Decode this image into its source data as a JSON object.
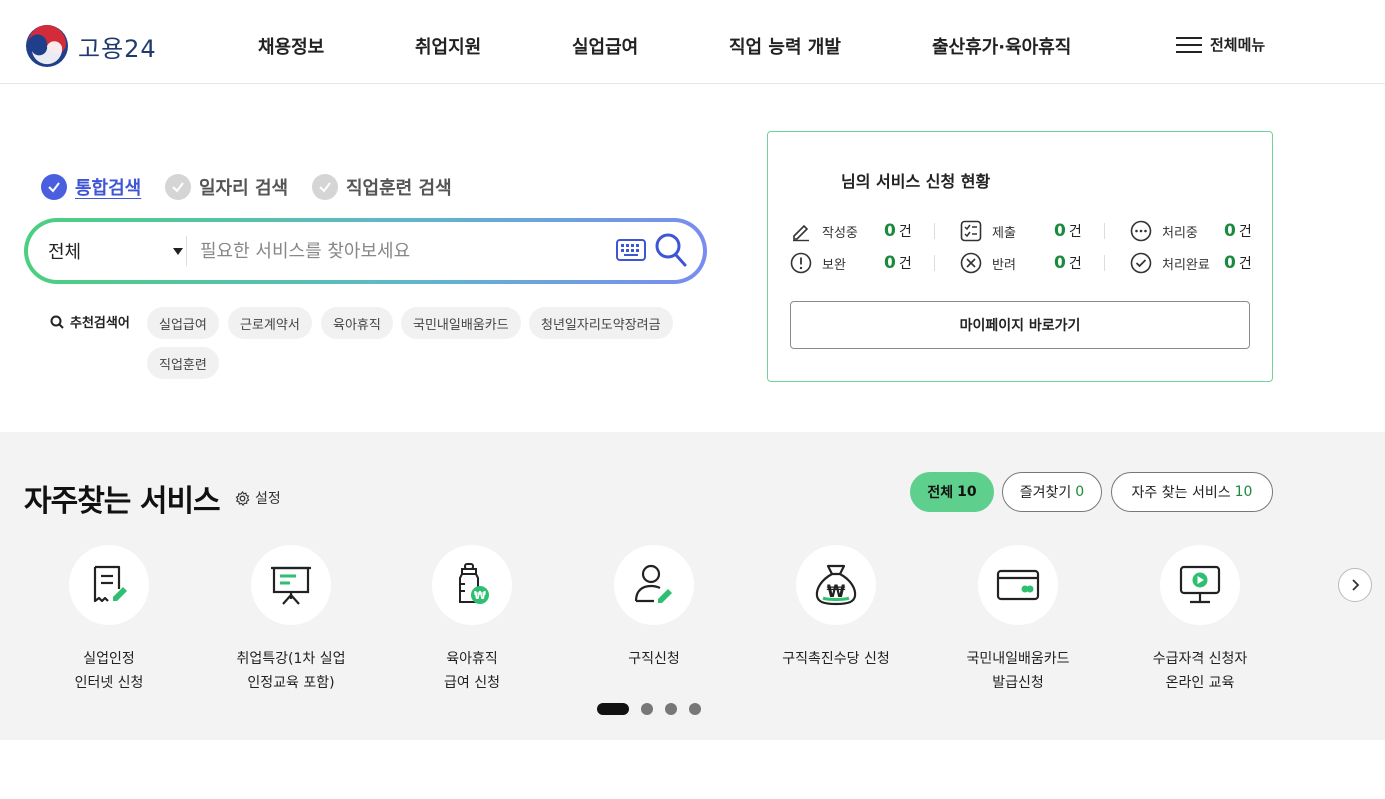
{
  "header": {
    "logo_text": "고용24",
    "nav": [
      "채용정보",
      "취업지원",
      "실업급여",
      "직업 능력 개발",
      "출산휴가·육아휴직"
    ],
    "all_menu_label": "전체메뉴"
  },
  "search": {
    "tabs": [
      {
        "label": "통합검색",
        "active": true
      },
      {
        "label": "일자리 검색",
        "active": false
      },
      {
        "label": "직업훈련 검색",
        "active": false
      }
    ],
    "select_value": "전체",
    "placeholder": "필요한 서비스를 찾아보세요",
    "recommend_title": "추천검색어",
    "recommend_keywords": [
      "실업급여",
      "근로계약서",
      "육아휴직",
      "국민내일배움카드",
      "청년일자리도약장려금",
      "직업훈련"
    ]
  },
  "status_card": {
    "title": "님의 서비스 신청 현황",
    "items": [
      {
        "label": "작성중",
        "count": "0",
        "unit": "건",
        "icon": "pencil-icon"
      },
      {
        "label": "제출",
        "count": "0",
        "unit": "건",
        "icon": "checklist-icon"
      },
      {
        "label": "처리중",
        "count": "0",
        "unit": "건",
        "icon": "more-icon"
      },
      {
        "label": "보완",
        "count": "0",
        "unit": "건",
        "icon": "alert-icon"
      },
      {
        "label": "반려",
        "count": "0",
        "unit": "건",
        "icon": "reject-icon"
      },
      {
        "label": "처리완료",
        "count": "0",
        "unit": "건",
        "icon": "complete-icon"
      }
    ],
    "mypage_button": "마이페이지 바로가기"
  },
  "frequent": {
    "title": "자주찾는 서비스",
    "setting_label": "설정",
    "filters": [
      {
        "label": "전체",
        "count": "10",
        "active": true
      },
      {
        "label": "즐겨찾기",
        "count": "0",
        "active": false
      },
      {
        "label": "자주 찾는 서비스",
        "count": "10",
        "active": false
      }
    ],
    "services": [
      {
        "line1": "실업인정",
        "line2": "인터넷 신청",
        "icon": "document-edit-icon"
      },
      {
        "line1": "취업특강(1차 실업",
        "line2": "인정교육 포함)",
        "icon": "presentation-board-icon"
      },
      {
        "line1": "육아휴직",
        "line2": "급여 신청",
        "icon": "baby-bottle-won-icon"
      },
      {
        "line1": "구직신청",
        "line2": "",
        "icon": "person-edit-icon"
      },
      {
        "line1": "구직촉진수당 신청",
        "line2": "",
        "icon": "money-bag-won-icon"
      },
      {
        "line1": "국민내일배움카드",
        "line2": "발급신청",
        "icon": "card-icon"
      },
      {
        "line1": "수급자격 신청자",
        "line2": "온라인 교육",
        "icon": "monitor-play-icon"
      }
    ],
    "pagination": {
      "pages": 4,
      "current": 1
    }
  },
  "colors": {
    "accent_blue": "#4a5fe0",
    "accent_green": "#5ecf8c",
    "count_green": "#1a8a3e",
    "service_icon_green": "#2fbf71"
  }
}
